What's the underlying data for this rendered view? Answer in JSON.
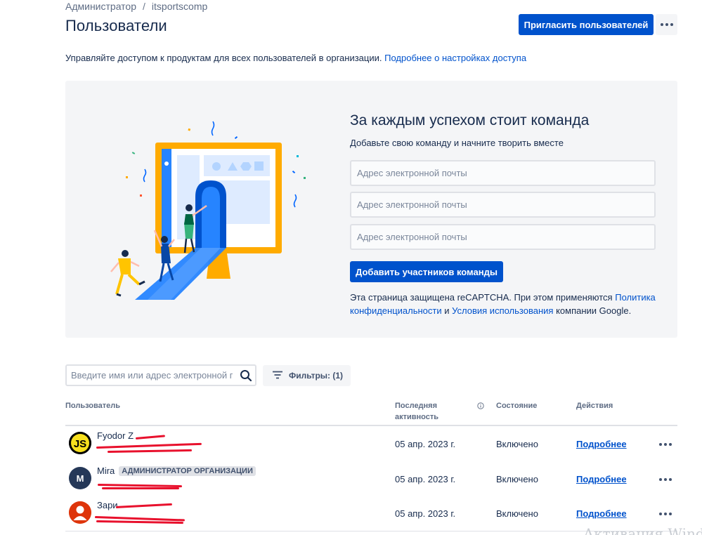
{
  "breadcrumb": {
    "items": [
      "Администратор",
      "itsportscomp"
    ],
    "separator": "/"
  },
  "header": {
    "title": "Пользователи",
    "invite_label": "Пригласить пользователей",
    "more_icon": "more-horizontal-icon"
  },
  "description": {
    "text": "Управляйте доступом к продуктам для всех пользователей в организации.",
    "link": "Подробнее о настройках доступа"
  },
  "promo": {
    "title": "За каждым успехом стоит команда",
    "subtitle": "Добавьте свою команду и начните творить вместе",
    "email_placeholder": "Адрес электронной почты",
    "add_button": "Добавить участников команды",
    "recaptcha_text_1": "Эта страница защищена reCAPTCHA. При этом применяются",
    "privacy_link": "Политика конфиденциальности",
    "recaptcha_and": "и",
    "terms_link": "Условия использования",
    "recaptcha_suffix": "компании Google."
  },
  "search": {
    "placeholder": "Введите имя или адрес электронной почты",
    "icon": "search-icon"
  },
  "filter": {
    "label": "Фильтры: (1)",
    "icon": "filter-icon"
  },
  "table": {
    "headers": {
      "user": "Пользователь",
      "activity": "Последняя активность",
      "state": "Состояние",
      "actions": "Действия"
    },
    "rows": [
      {
        "name": "Fyodor Z",
        "badge": "",
        "avatar_text": "JS",
        "last_active": "05 апр. 2023 г.",
        "state": "Включено",
        "action": "Подробнее"
      },
      {
        "name": "Mira",
        "badge": "АДМИНИСТРАТОР ОРГАНИЗАЦИИ",
        "avatar_text": "M",
        "last_active": "05 апр. 2023 г.",
        "state": "Включено",
        "action": "Подробнее"
      },
      {
        "name": "Зари",
        "badge": "",
        "avatar_text": "",
        "last_active": "05 апр. 2023 г.",
        "state": "Включено",
        "action": "Подробнее"
      }
    ]
  },
  "colors": {
    "primary": "#0052cc",
    "redaction": "#e8112d",
    "avatar_js": "#f7df1e",
    "avatar_m": "#253858",
    "avatar_user": "#de350b"
  },
  "watermark": "Активация Windows"
}
